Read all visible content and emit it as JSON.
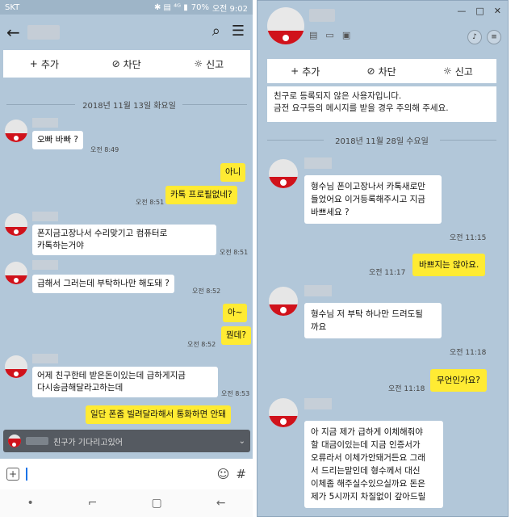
{
  "left": {
    "status": {
      "carrier": "SKT",
      "icons": "✱ ▤ ⁴ᴳ ▮",
      "battery": "70%",
      "time": "오전 9:02"
    },
    "header": {
      "back": "←",
      "search": "⌕",
      "menu": "☰"
    },
    "actions": [
      {
        "icon": "+",
        "label": "추가"
      },
      {
        "icon": "⊘",
        "label": "차단"
      },
      {
        "icon": "☼",
        "label": "신고"
      }
    ],
    "date": "2018년 11월 13일 화요일",
    "messages": [
      {
        "side": "in",
        "text": "오빠 바빠 ?",
        "time": "오전 8:49"
      },
      {
        "side": "out",
        "text": "아니",
        "time": ""
      },
      {
        "side": "out",
        "text": "카톡  프로필없네?",
        "time": "오전 8:51"
      },
      {
        "side": "in",
        "text": "폰지금고장나서 수리맞기고 컴퓨터로\n카톡하는거야",
        "time": "오전 8:51"
      },
      {
        "side": "in",
        "text": "급해서 그러는데 부탁하나만 해도돼 ?",
        "time": "오전 8:52"
      },
      {
        "side": "out",
        "text": "아~",
        "time": ""
      },
      {
        "side": "out",
        "text": "뭔데?",
        "time": "오전 8:52"
      },
      {
        "side": "in",
        "text": "어제 친구한테 받은돈이있는데 급하게지금\n다시송금해달라고하는데",
        "time": "오전 8:53"
      },
      {
        "side": "out",
        "text": "일단 폰좀 빌려달라해서 통화하면 안돼",
        "time": ""
      }
    ],
    "waiting": "친구가 기다리고있어",
    "waiting_icon": "⌄",
    "input": {
      "plus": "+",
      "emoji": "☺",
      "hash": "#"
    },
    "nav": {
      "recent": "•",
      "home": "⌐",
      "square": "▢",
      "back": "←"
    }
  },
  "right": {
    "window": {
      "min": "—",
      "max": "□",
      "close": "✕"
    },
    "tools": [
      "▤",
      "▭",
      "▣"
    ],
    "right_icons": [
      "♪",
      "≡"
    ],
    "actions": [
      {
        "icon": "+",
        "label": "추가"
      },
      {
        "icon": "⊘",
        "label": "차단"
      },
      {
        "icon": "☼",
        "label": "신고"
      }
    ],
    "notice": "친구로 등록되지 않은 사용자입니다.\n금전 요구등의 메시지를 받을 경우 주의해 주세요.",
    "date": "2018년 11월 28일 수요일",
    "messages": [
      {
        "side": "in",
        "text": "형수님 폰이고장나서 카톡새로만\n들었어요 이거등록해주시고 지금\n바쁘세요 ?",
        "time": "오전 11:15"
      },
      {
        "side": "out",
        "text": "바쁘지는 않아요.",
        "time": "오전 11:17"
      },
      {
        "side": "in",
        "text": "형수님 저 부탁 하나만 드려도될\n까요",
        "time": "오전 11:18"
      },
      {
        "side": "out",
        "text": "무언인가요?",
        "time": "오전 11:18"
      },
      {
        "side": "in",
        "text": "아 지금 제가 급하게 이체해줘야\n할 대금이있는데 지금 인증서가\n오류라서 이체가안돼거든요 그래\n서 드리는말인데 형수께서 대신\n이체좀 해주실수있으실까요 돈은\n제가 5시까지 차질없이 갚아드릴",
        "time": ""
      }
    ]
  }
}
